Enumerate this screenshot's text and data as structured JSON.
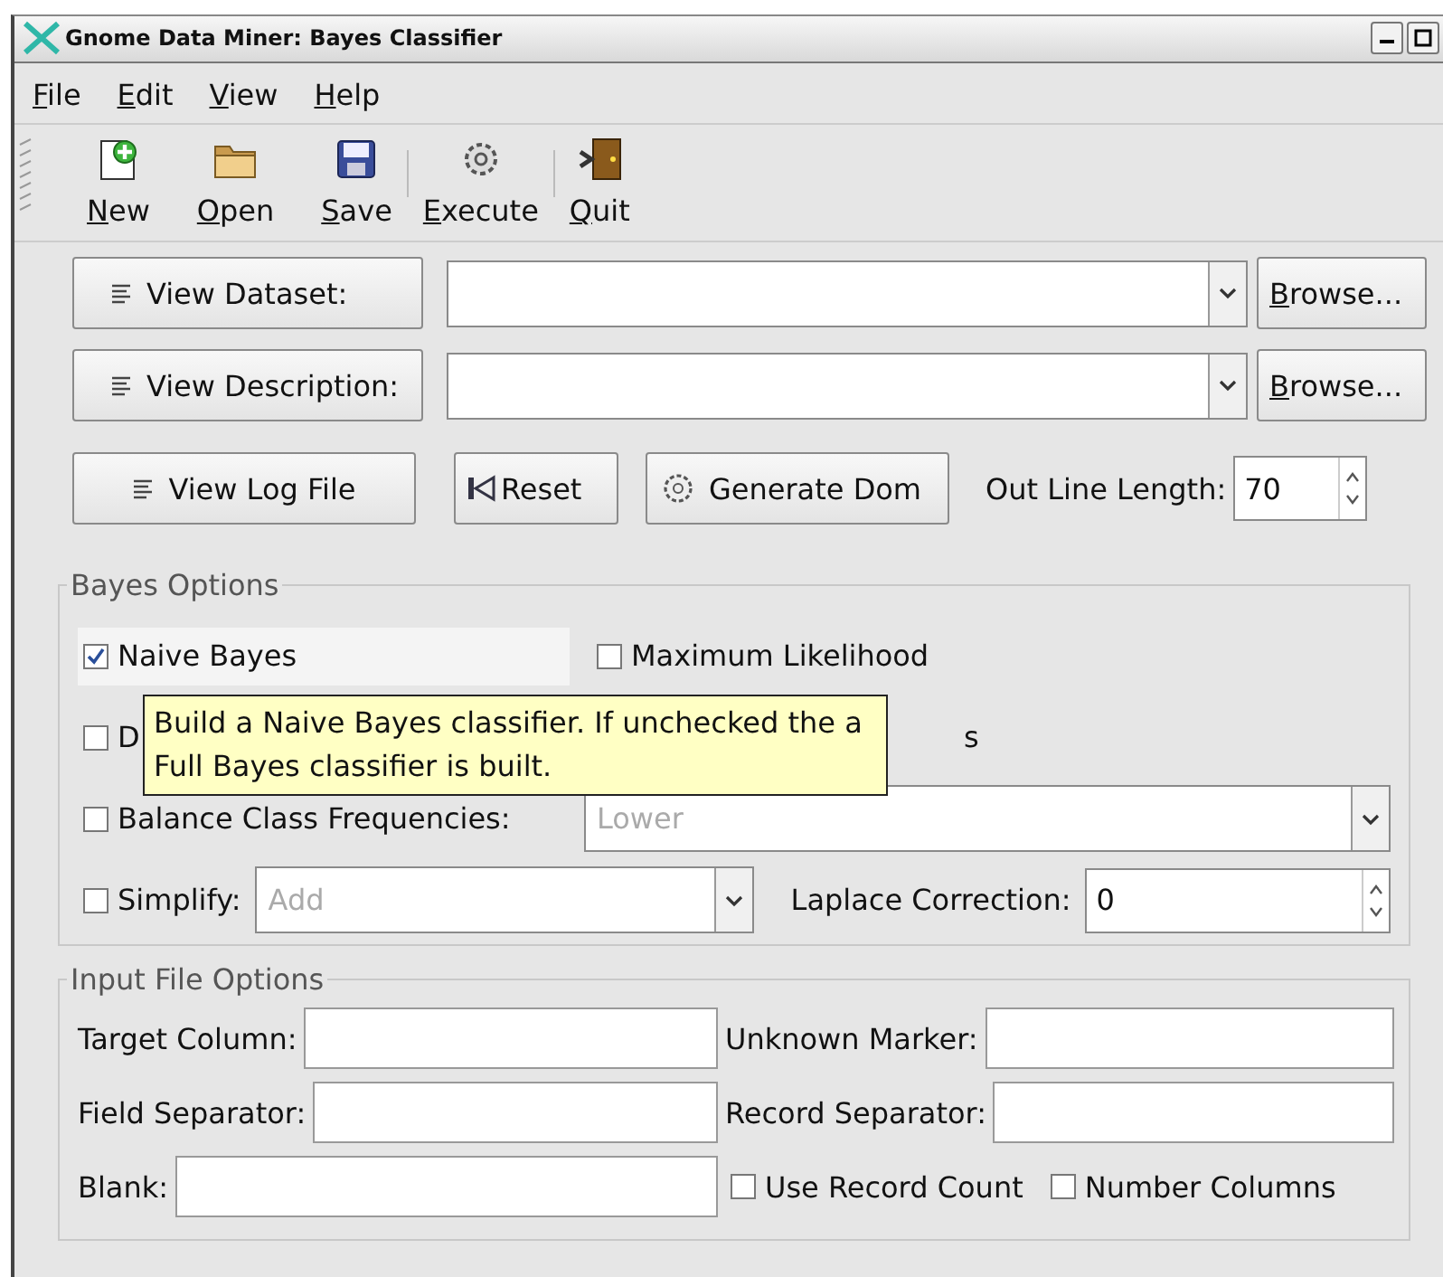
{
  "window": {
    "title": "Gnome Data Miner: Bayes Classifier"
  },
  "menu": [
    {
      "label": "File"
    },
    {
      "label": "Edit"
    },
    {
      "label": "View"
    },
    {
      "label": "Help"
    }
  ],
  "toolbar": [
    {
      "kind": "new",
      "label": "New"
    },
    {
      "kind": "open",
      "label": "Open"
    },
    {
      "kind": "save",
      "label": "Save"
    },
    {
      "kind": "separator"
    },
    {
      "kind": "execute",
      "label": "Execute"
    },
    {
      "kind": "separator"
    },
    {
      "kind": "quit",
      "label": "Quit"
    }
  ],
  "file_rows": [
    {
      "button": "View Dataset:",
      "browse": "Browse..."
    },
    {
      "button": "View Description:",
      "browse": "Browse..."
    }
  ],
  "action_row": {
    "buttons": [
      {
        "kind": "log",
        "label": "View Log File"
      },
      {
        "kind": "reset",
        "label": "Reset"
      },
      {
        "kind": "generate",
        "label": "Generate Dom"
      }
    ],
    "spin_label": "Out Line Length:",
    "spin_value": "70"
  },
  "bayes_options": {
    "title": "Bayes Options",
    "rows": [
      {
        "kind": "pair",
        "items": [
          {
            "label": "Naive Bayes",
            "checked": true,
            "hover": true
          },
          {
            "label": "Maximum Likelihood",
            "checked": false,
            "hover": false
          }
        ]
      },
      {
        "kind": "partial",
        "label": "D",
        "checked": false,
        "trailing": "s"
      },
      {
        "kind": "combo",
        "label": "Balance Class Frequencies:",
        "checked": false,
        "combo": "Lower",
        "disabled": true
      },
      {
        "kind": "combo_spin",
        "label": "Simplify:",
        "checked": false,
        "combo": "Add",
        "disabled": true,
        "spin_label": "Laplace Correction:",
        "spin_value": "0"
      }
    ],
    "tooltip": "Build a Naive Bayes classifier. If unchecked the a Full Bayes classifier is built."
  },
  "input_options": {
    "title": "Input File Options",
    "rows": [
      {
        "kind": "fields",
        "items": [
          {
            "label": "Target Column:"
          },
          {
            "label": "Unknown Marker:"
          }
        ]
      },
      {
        "kind": "fields",
        "items": [
          {
            "label": "Field Separator:"
          },
          {
            "label": "Record Separator:"
          }
        ]
      },
      {
        "kind": "field_checks",
        "label": "Blank:",
        "checks": [
          {
            "label": "Use Record Count",
            "checked": false
          },
          {
            "label": "Number Columns",
            "checked": false
          }
        ]
      }
    ]
  }
}
